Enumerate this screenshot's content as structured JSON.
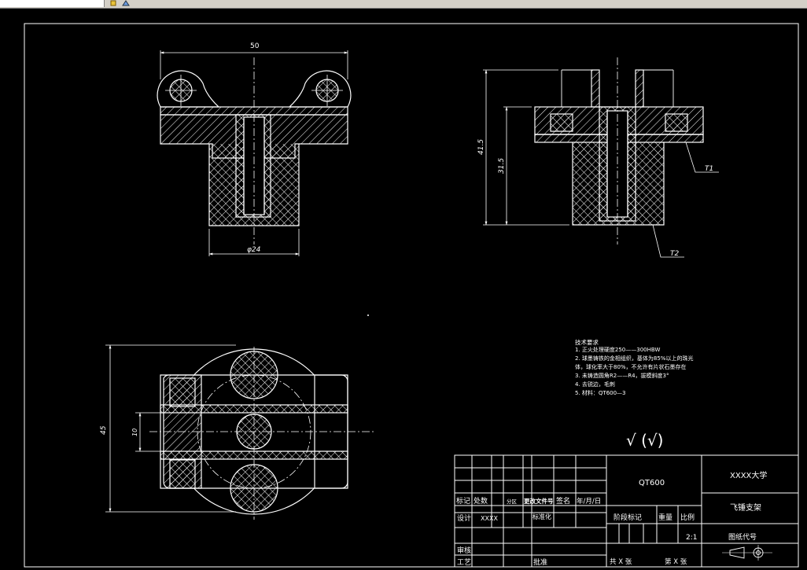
{
  "toolbar": {
    "icons": [
      "tool-icon-a",
      "tool-icon-b"
    ]
  },
  "drawing": {
    "dims": {
      "top_left_width": "50",
      "top_left_bottom_dia": "φ24",
      "top_right_height_outer": "41.5",
      "top_right_height_inner": "31.5",
      "top_right_leader_1": "T1",
      "top_right_leader_2": "T2",
      "bottom_height": "45",
      "bottom_slot": "10"
    },
    "notes": {
      "heading": "技术要求",
      "lines": [
        "1. 正火处理硬度250——300HBW",
        "2. 球墨铸铁的金相组织，基体为85%以上的珠光",
        "体，球化率大于80%，不允许有片状石墨存在",
        "3. 未铸造圆角R2——R4，拔模斜度3°",
        "4. 去锐边，毛刺",
        "5. 材料：QT600—3"
      ]
    },
    "roughness": "√ (√)"
  },
  "title_block": {
    "material": "QT600",
    "school": "XXXX大学",
    "part_name": "飞锤支架",
    "drawing_code": "图纸代号",
    "scale_value": "2:1",
    "headers": {
      "mark": "标记",
      "count": "处数",
      "zone": "分区",
      "change_doc": "更改文件号",
      "signature": "签名",
      "date": "年/月/日",
      "design": "设计",
      "designer": "XXXX",
      "standardize": "标准化",
      "stage_mark": "阶段标记",
      "weight": "重量",
      "scale": "比例",
      "review": "审核",
      "process": "工艺",
      "approve": "批准",
      "total_sheets": "共 X 张",
      "sheet_no": "第 X 张"
    }
  }
}
